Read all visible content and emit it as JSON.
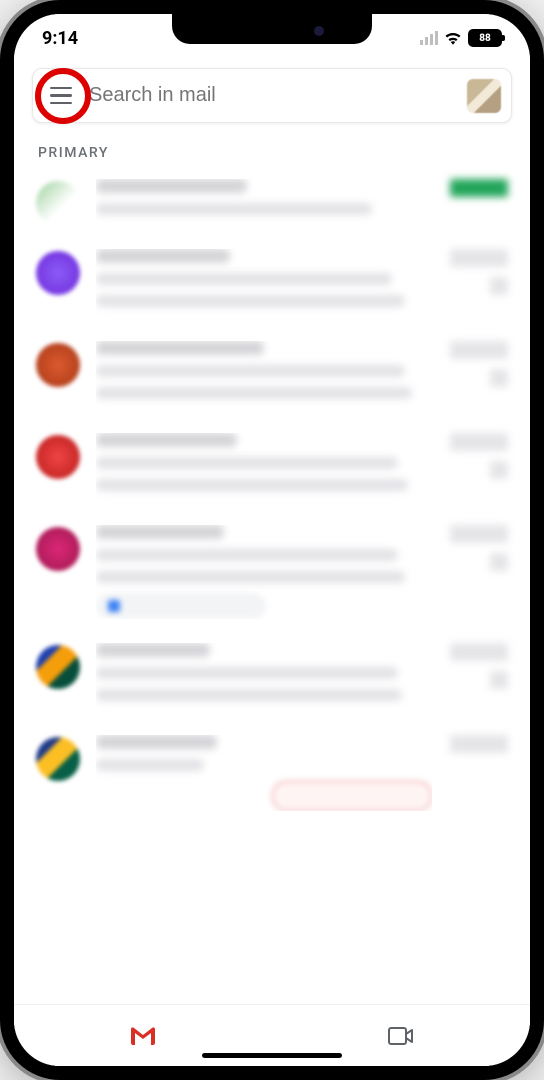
{
  "status": {
    "time": "9:14",
    "battery": "88"
  },
  "search": {
    "placeholder": "Search in mail"
  },
  "section_label": "PRIMARY",
  "bottom": {
    "mail_label": "Mail",
    "meet_label": "Meet"
  }
}
